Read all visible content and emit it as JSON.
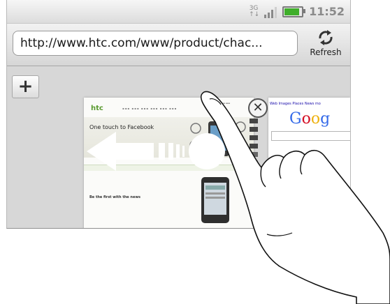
{
  "status_bar": {
    "network": "3G",
    "arrows": "↑↓",
    "time": "11:52",
    "battery_level": 0.8,
    "signal_bars": 3
  },
  "url_bar": {
    "url": "http://www.htc.com/www/product/chac...",
    "refresh_label": "Refresh"
  },
  "tabs": {
    "add_label": "+",
    "close_label": "✕",
    "htc_page": {
      "logo": "htc",
      "headline": "One touch to Facebook",
      "footer_headline": "Be the first with the news"
    },
    "google_page": {
      "links": "Web  Images  Places  News  mo",
      "logo": "Goog"
    }
  },
  "colors": {
    "google_blue": "#3369e8",
    "google_red": "#d50f25",
    "google_yellow": "#eeb211",
    "htc_green": "#5a9a30",
    "battery_green": "#3fae2a"
  }
}
